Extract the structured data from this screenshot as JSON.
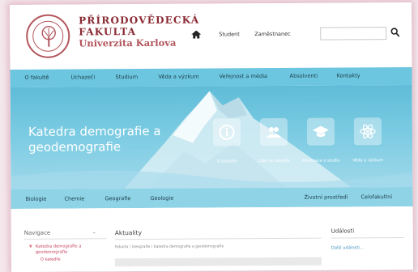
{
  "header": {
    "logo": {
      "line1": "PŘÍRODOVĚDECKÁ",
      "line2": "FAKULTA",
      "line3": "Univerzita Karlova"
    },
    "links": [
      "Student",
      "Zaměstnanec"
    ],
    "search": {
      "placeholder": "",
      "value": ""
    }
  },
  "nav": {
    "items": [
      "O fakultě",
      "Uchazeči",
      "Studium",
      "Věda a výzkum",
      "Veřejnost a média",
      "Absolventi",
      "Kontakty"
    ]
  },
  "hero": {
    "title": "Katedra demografie a geodemografie",
    "buttons": [
      {
        "label": "O katedře",
        "icon": "info-icon"
      },
      {
        "label": "Lidé na katedře",
        "icon": "people-icon"
      },
      {
        "label": "Informace o studiu",
        "icon": "graduation-cap-icon"
      },
      {
        "label": "Věda a výzkum",
        "icon": "atom-icon"
      }
    ]
  },
  "subnav": {
    "items": [
      "Biologie",
      "Chemie",
      "Geografie",
      "Geologie",
      "Životní prostředí",
      "Celofakultní"
    ]
  },
  "sidebar": {
    "title": "Navigace",
    "active_item": "Katedra demografie a geodemografie",
    "sub_item": "Ο katedře"
  },
  "main": {
    "title": "Aktuality",
    "breadcrumb": "Fakulta / Geografie / Katedra demografie a geodemografie"
  },
  "events": {
    "title": "Události",
    "more_link": "Další události..."
  },
  "colors": {
    "brand": "#8a2a33",
    "nav": "#6cc6df",
    "subnav": "#8ed3e6",
    "link": "#c33c5c"
  }
}
